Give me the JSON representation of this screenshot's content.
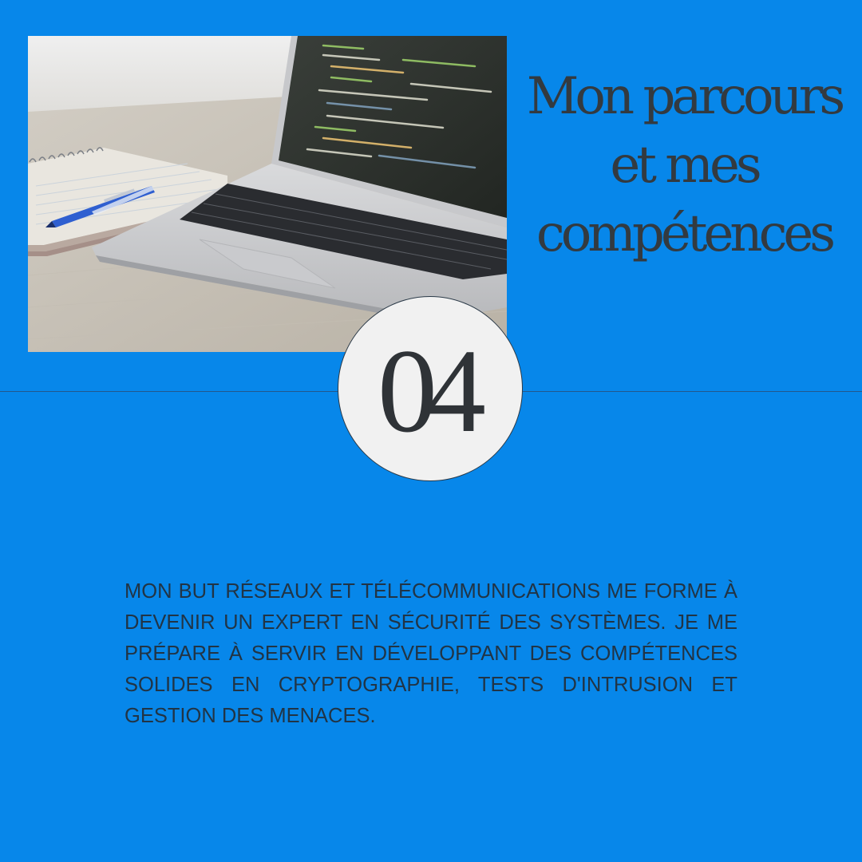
{
  "colors": {
    "background": "#0787ea",
    "title_text": "#333a40",
    "body_text": "#213445",
    "badge_fill": "#f1f1f1"
  },
  "photo": {
    "subject": "laptop-with-code-and-notebook-photo"
  },
  "title": "Mon parcours et mes compétences",
  "badge": {
    "number": "04"
  },
  "description": "MON BUT RÉSEAUX ET TÉLÉCOMMUNICATIONS ME FORME À DEVENIR UN EXPERT EN SÉCURITÉ DES SYSTÈMES. JE ME PRÉPARE À SERVIR EN DÉVELOPPANT DES COMPÉTENCES SOLIDES EN CRYPTOGRAPHIE, TESTS D'INTRUSION ET GESTION DES MENACES."
}
